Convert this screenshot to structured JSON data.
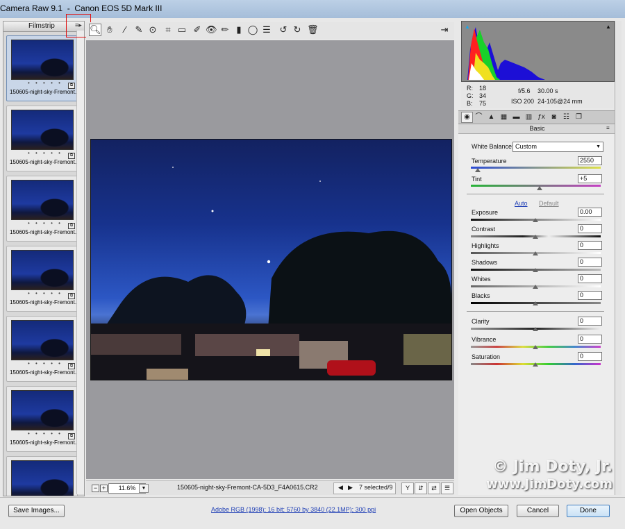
{
  "window": {
    "title": "Camera Raw 9.1  -  Canon EOS 5D Mark III"
  },
  "filmstrip": {
    "title": "Filmstrip",
    "items": [
      {
        "name": "150605-night-sky-Fremont..."
      },
      {
        "name": "150605-night-sky-Fremont..."
      },
      {
        "name": "150605-night-sky-Fremont..."
      },
      {
        "name": "150605-night-sky-Fremont..."
      },
      {
        "name": "150605-night-sky-Fremont..."
      },
      {
        "name": "150605-night-sky-Fremont..."
      },
      {
        "name": ""
      }
    ],
    "rating_dots": "• • • • •"
  },
  "toolbar": {
    "tools": [
      "zoom-icon",
      "hand-icon",
      "white-balance-icon",
      "color-sampler-icon",
      "target-adjust-icon",
      "crop-icon",
      "straighten-icon",
      "spot-removal-icon",
      "red-eye-icon",
      "adjustment-brush-icon",
      "graduated-filter-icon",
      "radial-filter-icon",
      "preferences-icon",
      "rotate-left-icon",
      "rotate-right-icon",
      "trash-icon"
    ]
  },
  "preview": {
    "zoom": "11.6%",
    "filename": "150605-night-sky-Fremont-CA-5D3_F4A0615.CR2",
    "selection": "7 selected/9"
  },
  "readout": {
    "r_label": "R:",
    "r_value": "18",
    "g_label": "G:",
    "g_value": "34",
    "b_label": "B:",
    "b_value": "75",
    "aperture": "f/5.6",
    "shutter": "30.00 s",
    "iso": "ISO 200",
    "lens": "24-105@24 mm"
  },
  "panel": {
    "title": "Basic",
    "white_balance_label": "White Balance:",
    "white_balance_value": "Custom",
    "temperature_label": "Temperature",
    "temperature_value": "2550",
    "tint_label": "Tint",
    "tint_value": "+5",
    "auto_label": "Auto",
    "default_label": "Default",
    "exposure_label": "Exposure",
    "exposure_value": "0.00",
    "contrast_label": "Contrast",
    "contrast_value": "0",
    "highlights_label": "Highlights",
    "highlights_value": "0",
    "shadows_label": "Shadows",
    "shadows_value": "0",
    "whites_label": "Whites",
    "whites_value": "0",
    "blacks_label": "Blacks",
    "blacks_value": "0",
    "clarity_label": "Clarity",
    "clarity_value": "0",
    "vibrance_label": "Vibrance",
    "vibrance_value": "0",
    "saturation_label": "Saturation",
    "saturation_value": "0"
  },
  "footer": {
    "save_label": "Save Images...",
    "workflow_link": "Adobe RGB (1998); 16 bit; 5760 by 3840 (22.1MP); 300 ppi",
    "open_label": "Open Objects",
    "cancel_label": "Cancel",
    "done_label": "Done"
  },
  "watermark": {
    "line1": "© Jim Doty, Jr.",
    "line2": "www.JimDoty.com"
  }
}
